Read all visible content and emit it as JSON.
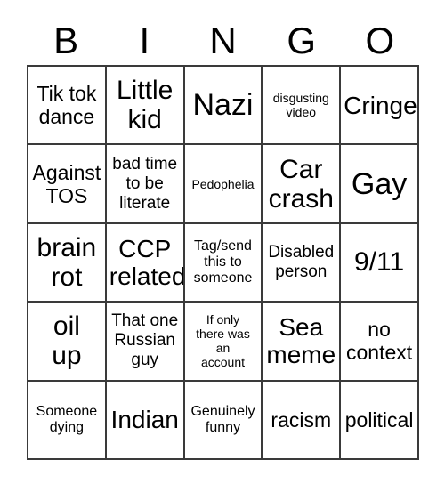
{
  "card": {
    "title": "BINGO",
    "header_letters": [
      "B",
      "I",
      "N",
      "G",
      "O"
    ],
    "grid_size": "5x5",
    "colors": {
      "background": "#ffffff",
      "text": "#000000",
      "border": "#3a3a3a"
    },
    "rows": [
      [
        {
          "text": "Tik tok\ndance",
          "size": "fs-md"
        },
        {
          "text": "Little\nkid",
          "size": "fs-xl"
        },
        {
          "text": "Nazi",
          "size": "fs-xxl"
        },
        {
          "text": "disgusting\nvideo",
          "size": "fs-xxs"
        },
        {
          "text": "Cringe",
          "size": "fs-lg"
        }
      ],
      [
        {
          "text": "Against\nTOS",
          "size": "fs-md"
        },
        {
          "text": "bad time\nto be\nliterate",
          "size": "fs-sm"
        },
        {
          "text": "Pedophelia",
          "size": "fs-xxs"
        },
        {
          "text": "Car\ncrash",
          "size": "fs-xl"
        },
        {
          "text": "Gay",
          "size": "fs-xxl"
        }
      ],
      [
        {
          "text": "brain\nrot",
          "size": "fs-xl"
        },
        {
          "text": "CCP\nrelated",
          "size": "fs-lg"
        },
        {
          "text": "Tag/send\nthis to\nsomeone",
          "size": "fs-xs"
        },
        {
          "text": "Disabled\nperson",
          "size": "fs-sm"
        },
        {
          "text": "9/11",
          "size": "fs-xl"
        }
      ],
      [
        {
          "text": "oil\nup",
          "size": "fs-xl"
        },
        {
          "text": "That one\nRussian\nguy",
          "size": "fs-sm"
        },
        {
          "text": "If only\nthere was\nan\naccount",
          "size": "fs-xxs"
        },
        {
          "text": "Sea\nmeme",
          "size": "fs-lg"
        },
        {
          "text": "no\ncontext",
          "size": "fs-md"
        }
      ],
      [
        {
          "text": "Someone\ndying",
          "size": "fs-xs"
        },
        {
          "text": "Indian",
          "size": "fs-lg"
        },
        {
          "text": "Genuinely\nfunny",
          "size": "fs-xs"
        },
        {
          "text": "racism",
          "size": "fs-md"
        },
        {
          "text": "political",
          "size": "fs-md"
        }
      ]
    ]
  }
}
